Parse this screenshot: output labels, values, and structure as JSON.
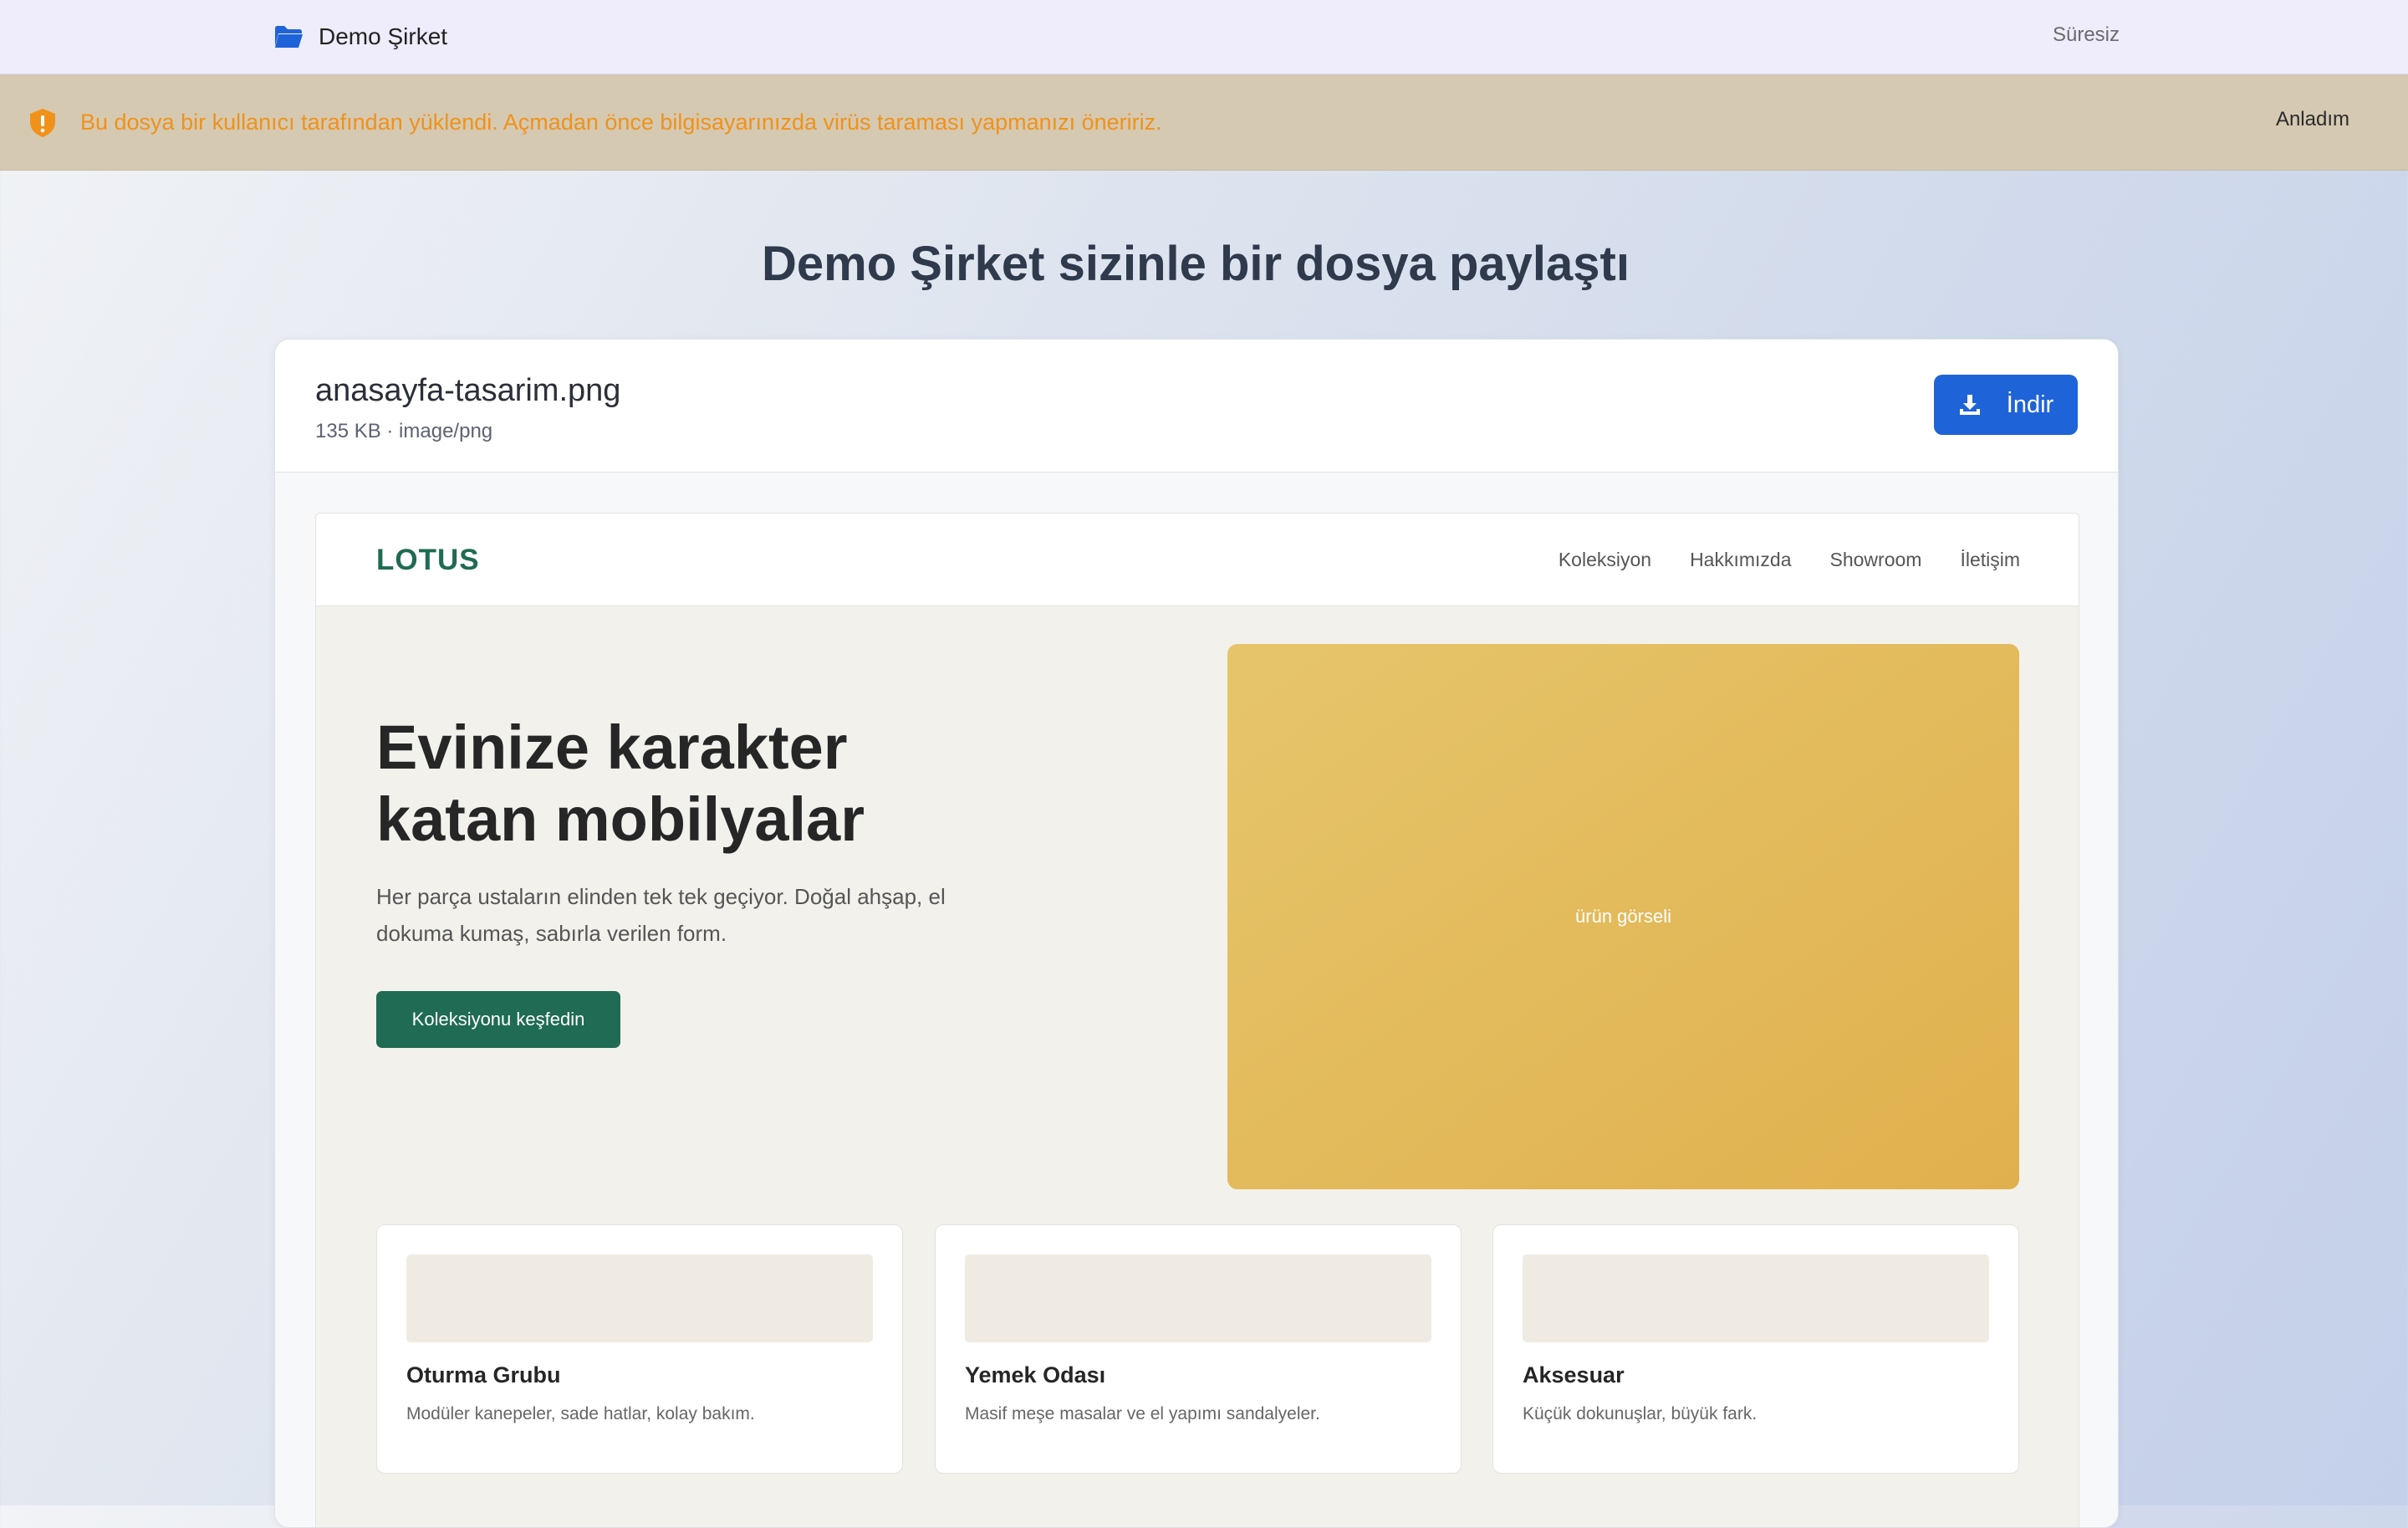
{
  "header": {
    "brand_icon": "folder-icon",
    "company": "Demo Şirket",
    "expiry": "Süresiz"
  },
  "banner": {
    "icon": "shield-warning-icon",
    "message": "Bu dosya bir kullanıcı tarafından yüklendi. Açmadan önce bilgisayarınızda virüs taraması yapmanızı öneririz.",
    "ack_label": "Anladım",
    "text_color": "#f0921a"
  },
  "page": {
    "title": "Demo Şirket sizinle bir dosya paylaştı"
  },
  "file": {
    "name": "anasayfa-tasarim.png",
    "meta": "135 KB · image/png",
    "download_label": "İndir",
    "download_icon": "download-icon",
    "accent": "#1f63d8"
  },
  "preview": {
    "logo": "LOTUS",
    "nav": [
      "Koleksiyon",
      "Hakkımızda",
      "Showroom",
      "İletişim"
    ],
    "hero": {
      "title_line1": "Evinize karakter",
      "title_line2": "katan mobilyalar",
      "subtitle": "Her parça ustaların elinden tek tek geçiyor. Doğal ahşap, el dokuma kumaş, sabırla verilen form.",
      "cta": "Koleksiyonu keşfedin",
      "image_label": "ürün görseli"
    },
    "categories": [
      {
        "title": "Oturma Grubu",
        "desc": "Modüler kanepeler, sade hatlar, kolay bakım."
      },
      {
        "title": "Yemek Odası",
        "desc": "Masif meşe masalar ve el yapımı sandalyeler."
      },
      {
        "title": "Aksesuar",
        "desc": "Küçük dokunuşlar, büyük fark."
      }
    ],
    "brand_color": "#1f6b53"
  }
}
